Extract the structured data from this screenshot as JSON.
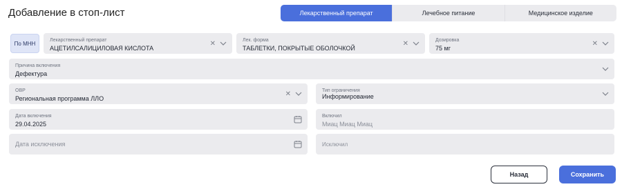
{
  "page": {
    "title": "Добавление в стоп-лист"
  },
  "tabs": [
    {
      "label": "Лекарственный препарат",
      "active": true
    },
    {
      "label": "Лечебное питание",
      "active": false
    },
    {
      "label": "Медицинское изделие",
      "active": false
    }
  ],
  "form": {
    "mnn_toggle": "По МНН",
    "drug": {
      "label": "Лекарственный препарат",
      "value": "АЦЕТИЛСАЛИЦИЛОВАЯ КИСЛОТА"
    },
    "form": {
      "label": "Лек. форма",
      "value": "ТАБЛЕТКИ, ПОКРЫТЫЕ ОБОЛОЧКОЙ"
    },
    "dosage": {
      "label": "Дозировка",
      "value": "75 мг"
    },
    "reason": {
      "label": "Причина включения",
      "value": "Дефектура"
    },
    "ovr": {
      "label": "ОВР",
      "value": "Региональная программа ЛЛО"
    },
    "restriction": {
      "label": "Тип ограничения",
      "value": "Информирование"
    },
    "include_date": {
      "label": "Дата включения",
      "value": "29.04.2025"
    },
    "included_by": {
      "label": "Включил",
      "value": "Миац Миац Миац"
    },
    "exclude_date": {
      "placeholder": "Дата исключения"
    },
    "excluded_by": {
      "placeholder": "Исключил"
    }
  },
  "buttons": {
    "back": "Назад",
    "save": "Сохранить"
  },
  "colors": {
    "accent": "#4a6fdc",
    "field_bg": "#ebebee"
  }
}
